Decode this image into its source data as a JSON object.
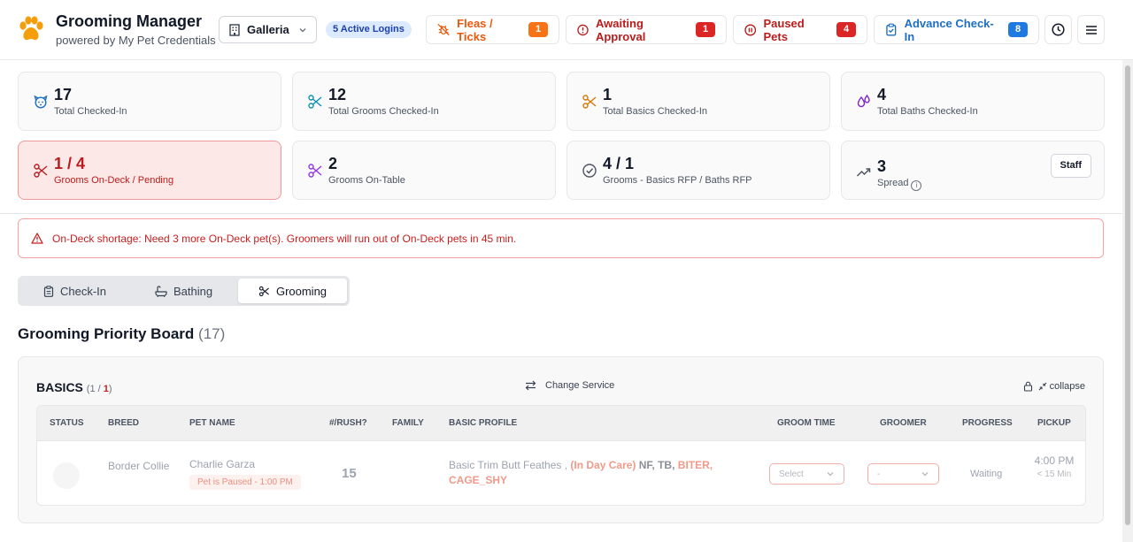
{
  "header": {
    "title": "Grooming Manager",
    "subtitle": "powered by My Pet Credentials",
    "location": "Galleria",
    "active_logins": "5 Active Logins",
    "buttons": {
      "fleas": {
        "label": "Fleas / Ticks",
        "count": "1"
      },
      "awaiting": {
        "label": "Awaiting Approval",
        "count": "1"
      },
      "paused": {
        "label": "Paused Pets",
        "count": "4"
      },
      "advance": {
        "label": "Advance Check-In",
        "count": "8"
      }
    }
  },
  "stats": [
    {
      "value": "17",
      "label": "Total Checked-In",
      "icon": "dog-face-icon"
    },
    {
      "value": "12",
      "label": "Total Grooms Checked-In",
      "icon": "scissors-icon"
    },
    {
      "value": "1",
      "label": "Total Basics Checked-In",
      "icon": "scissors-icon"
    },
    {
      "value": "4",
      "label": "Total Baths Checked-In",
      "icon": "droplets-icon"
    },
    {
      "value": "1 / 4",
      "label": "Grooms On-Deck / Pending",
      "icon": "scissors-icon"
    },
    {
      "value": "2",
      "label": "Grooms On-Table",
      "icon": "scissors-icon"
    },
    {
      "value": "4 / 1",
      "label": "Grooms - Basics RFP / Baths RFP",
      "icon": "check-circle-icon"
    },
    {
      "value": "3",
      "label": "Spread",
      "icon": "trending-up-icon",
      "button": "Staff"
    }
  ],
  "warning": "On-Deck shortage: Need 3 more On-Deck pet(s). Groomers will run out of On-Deck pets in 45 min.",
  "tabs": [
    {
      "label": "Check-In",
      "icon": "clipboard-icon"
    },
    {
      "label": "Bathing",
      "icon": "bathtub-icon"
    },
    {
      "label": "Grooming",
      "icon": "scissors-icon"
    }
  ],
  "board": {
    "title": "Grooming Priority Board",
    "count": "(17)",
    "section": {
      "title": "BASICS",
      "count_open": "(1 / ",
      "count_red": "1",
      "count_close": ")",
      "change_service": "Change Service",
      "collapse": "collapse",
      "columns": [
        "STATUS",
        "BREED",
        "PET NAME",
        "#/RUSH?",
        "FAMILY",
        "BASIC PROFILE",
        "GROOM TIME",
        "GROOMER",
        "PROGRESS",
        "PICKUP"
      ],
      "rows": [
        {
          "breed": "Border Collie",
          "pet_name": "Charlie Garza",
          "pause_note": "Pet is Paused - 1:00 PM",
          "rush": "15",
          "family": "",
          "profile_text": "Basic Trim Butt Feathes ,",
          "profile_daycare": "(In Day Care)",
          "profile_tags": "NF, TB,",
          "profile_red_tags": "BITER,",
          "profile_red_tags2": "CAGE_SHY",
          "groom_time": "Select",
          "groomer": "-",
          "progress": "Waiting",
          "pickup": "4:00 PM",
          "pickup_sub": "< 15 Min"
        }
      ]
    }
  }
}
